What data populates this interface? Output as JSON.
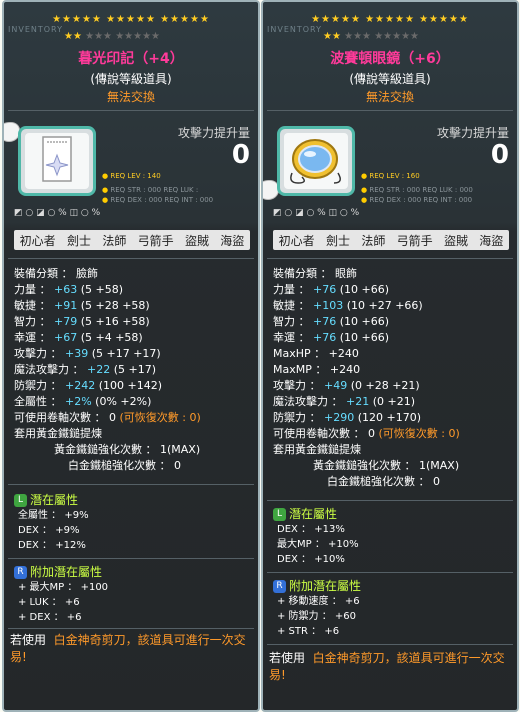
{
  "panels": [
    {
      "stars_row1": "★★★★★ ★★★★★ ★★★★★",
      "stars_row2_on": "★★",
      "stars_row2_off": "★★★ ★★★★★",
      "inventory_label": "INVENTORY",
      "item_name": "暮光印記（+4）",
      "grade_text": "(傳說等級道具)",
      "trade_text": "無法交換",
      "attack_label": "攻擊力提升量",
      "attack_value": "0",
      "req_lev": "REQ LEV :    140",
      "req_str_luk": "REQ STR :  000  REQ LUK :",
      "req_dex_int": "REQ DEX :  000  REQ INT :  000",
      "slots_text": "◩   ○ ◪   ○ %   ◫   ○ %",
      "jobs": [
        "初心者",
        "劍士",
        "法師",
        "弓箭手",
        "盜賊",
        "海盜"
      ],
      "stats": [
        {
          "label": "裝備分類 ： 臉飾",
          "extra": ""
        },
        {
          "label": "力量 ：",
          "value": "+63",
          "detail": "(5 +58)"
        },
        {
          "label": "敏捷 ：",
          "value": "+91",
          "detail": "(5 +28 +58)"
        },
        {
          "label": "智力 ：",
          "value": "+79",
          "detail": "(5 +16 +58)"
        },
        {
          "label": "幸運 ：",
          "value": "+67",
          "detail": "(5 +4 +58)"
        },
        {
          "label": "攻擊力 ：",
          "value": "+39",
          "detail": "(5 +17 +17)"
        },
        {
          "label": "魔法攻擊力 ：",
          "value": "+22",
          "detail": "(5 +17)"
        },
        {
          "label": "防禦力 ：",
          "value": "+242",
          "detail": "(100 +142)"
        },
        {
          "label": "全屬性 ：",
          "value": "+2%",
          "detail": "(0% +2%)"
        }
      ],
      "scroll_line": "可使用卷軸次數 ： 0",
      "scroll_recover": "(可恢復次數 : 0)",
      "hammer_line": "套用黃金鐵鎚提煉",
      "gold_hammer": "黃金鐵鎚強化次數 ： 1(MAX)",
      "plat_hammer": "白金鐵槌強化次數 ： 0",
      "potential_title": "潛在屬性",
      "potential_lines": [
        "全屬性 ： +9%",
        "DEX ： +9%",
        "DEX ： +12%"
      ],
      "bonus_title": "附加潛在屬性",
      "bonus_lines": [
        "+ 最大MP ： +100",
        "+ LUK ： +6",
        "+ DEX ： +6"
      ],
      "scissor_prefix": "若使用",
      "scissor_highlight": "白金神奇剪刀，該道具可進行一次交易!"
    },
    {
      "stars_row1": "★★★★★ ★★★★★ ★★★★★",
      "stars_row2_on": "★★",
      "stars_row2_off": "★★★ ★★★★★",
      "inventory_label": "INVENTORY",
      "item_name": "波賽頓眼鏡（+6）",
      "grade_text": "(傳說等級道具)",
      "trade_text": "無法交換",
      "attack_label": "攻擊力提升量",
      "attack_value": "0",
      "req_lev": "REQ LEV :    160",
      "req_str_luk": "REQ STR :  000  REQ LUK :  000",
      "req_dex_int": "REQ DEX :  000  REQ INT :  000",
      "slots_text": "◩   ○ ◪   ○ %   ◫   ○ %",
      "jobs": [
        "初心者",
        "劍士",
        "法師",
        "弓箭手",
        "盜賊",
        "海盜"
      ],
      "stats": [
        {
          "label": "裝備分類 ： 眼飾",
          "extra": ""
        },
        {
          "label": "力量 ：",
          "value": "+76",
          "detail": "(10 +66)"
        },
        {
          "label": "敏捷 ：",
          "value": "+103",
          "detail": "(10 +27 +66)"
        },
        {
          "label": "智力 ：",
          "value": "+76",
          "detail": "(10 +66)"
        },
        {
          "label": "幸運 ：",
          "value": "+76",
          "detail": "(10 +66)"
        },
        {
          "label": "MaxHP ：",
          "value": "+240",
          "detail": ""
        },
        {
          "label": "MaxMP ：",
          "value": "+240",
          "detail": ""
        },
        {
          "label": "攻擊力 ：",
          "value": "+49",
          "detail": "(0 +28 +21)"
        },
        {
          "label": "魔法攻擊力 ：",
          "value": "+21",
          "detail": "(0 +21)"
        },
        {
          "label": "防禦力 ：",
          "value": "+290",
          "detail": "(120 +170)"
        }
      ],
      "scroll_line": "可使用卷軸次數 ： 0",
      "scroll_recover": "(可恢復次數 : 0)",
      "hammer_line": "套用黃金鐵鎚提煉",
      "gold_hammer": "黃金鐵鎚強化次數 ： 1(MAX)",
      "plat_hammer": "白金鐵槌強化次數 ： 0",
      "potential_title": "潛在屬性",
      "potential_lines": [
        "DEX ： +13%",
        "最大MP ： +10%",
        "DEX ： +10%"
      ],
      "bonus_title": "附加潛在屬性",
      "bonus_lines": [
        "+ 移動速度 ： +6",
        "+ 防禦力 ： +60",
        "+ STR ： +6"
      ],
      "scissor_prefix": "若使用",
      "scissor_highlight": "白金神奇剪刀，該道具可進行一次交易!"
    }
  ],
  "colors": {
    "title": "#ff3a9a",
    "stat_value": "#66ddff",
    "bonus_value": "#ccff44",
    "warning": "#ff9a2a"
  }
}
